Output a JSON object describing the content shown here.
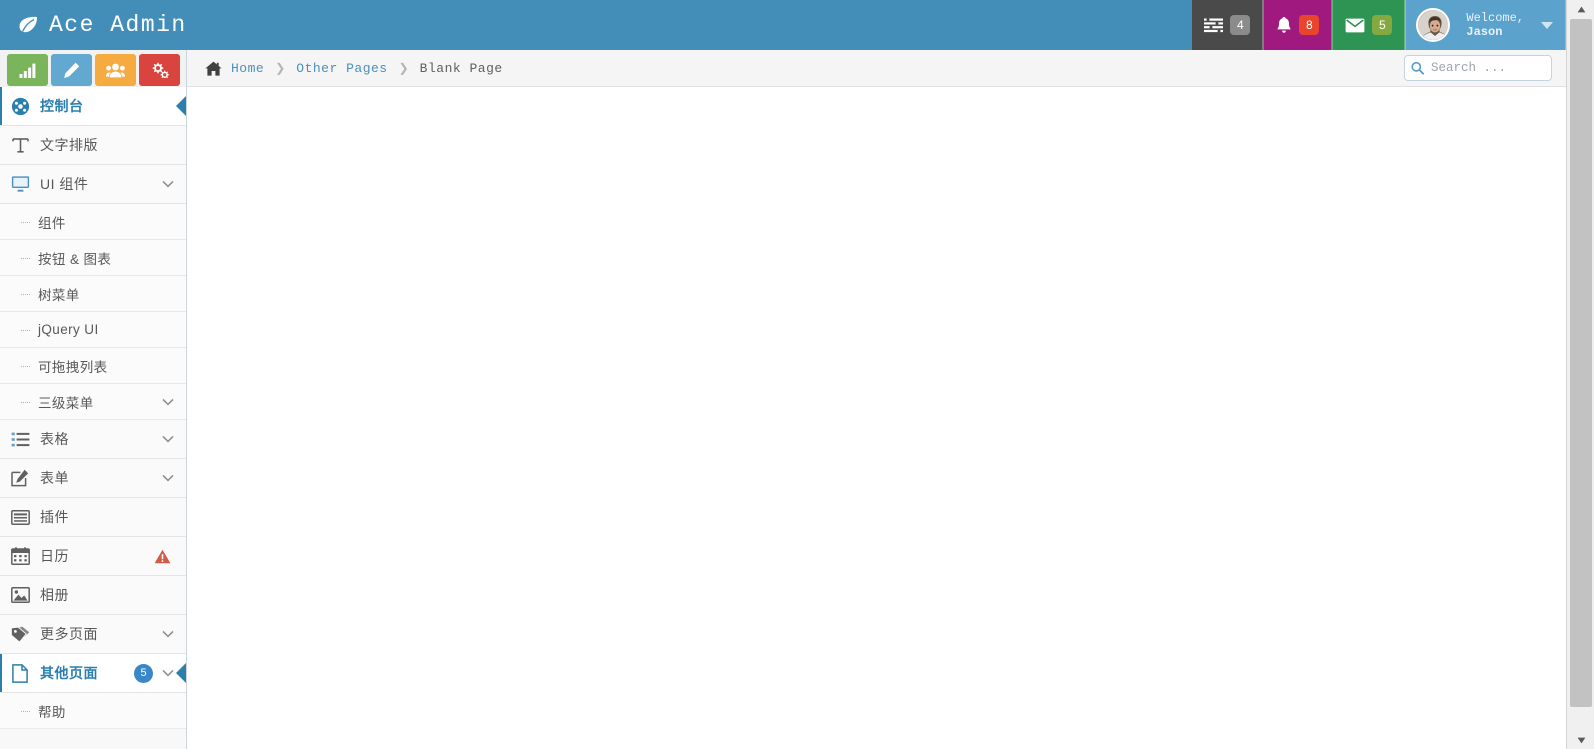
{
  "app": {
    "brand": "Ace Admin",
    "brand_icon": "leaf-icon",
    "header_color": "#438eb9"
  },
  "navbar": {
    "buttons": [
      {
        "name": "tasks",
        "icon": "tasks-icon",
        "badge": "4",
        "badge_color": "#8b8b8b",
        "bg": "#4a4a4a"
      },
      {
        "name": "notifications",
        "icon": "bell-icon",
        "badge": "8",
        "badge_color": "#e8452c",
        "bg": "#a0197f"
      },
      {
        "name": "messages",
        "icon": "envelope-icon",
        "badge": "5",
        "badge_color": "#85a941",
        "bg": "#2e9453"
      }
    ],
    "user": {
      "avatar_icon": "user-avatar",
      "greeting": "Welcome,",
      "username": "Jason",
      "caret_icon": "chevron-down-icon"
    }
  },
  "shortcuts": [
    {
      "name": "chart-shortcut",
      "icon": "signal-icon",
      "color": "#7ab55c"
    },
    {
      "name": "edit-shortcut",
      "icon": "pencil-icon",
      "color": "#62a8d1"
    },
    {
      "name": "users-shortcut",
      "icon": "group-icon",
      "color": "#f5ab3f"
    },
    {
      "name": "settings-shortcut",
      "icon": "cogs-icon",
      "color": "#d9443f"
    }
  ],
  "sidebar": {
    "items": [
      {
        "label": "控制台",
        "icon": "dashboard-icon",
        "active": true,
        "has_chevron": false
      },
      {
        "label": "文字排版",
        "icon": "typography-icon",
        "active": false,
        "has_chevron": false
      },
      {
        "label": "UI 组件",
        "icon": "monitor-icon",
        "active": false,
        "has_chevron": true
      },
      {
        "label": "表格",
        "icon": "list-icon",
        "active": false,
        "has_chevron": true
      },
      {
        "label": "表单",
        "icon": "edit-icon",
        "active": false,
        "has_chevron": true
      },
      {
        "label": "插件",
        "icon": "plugin-icon",
        "active": false,
        "has_chevron": false
      },
      {
        "label": "日历",
        "icon": "calendar-icon",
        "active": false,
        "has_chevron": false,
        "warning": "warning-icon"
      },
      {
        "label": "相册",
        "icon": "picture-icon",
        "active": false,
        "has_chevron": false
      },
      {
        "label": "更多页面",
        "icon": "tag-icon",
        "active": false,
        "has_chevron": true
      },
      {
        "label": "其他页面",
        "icon": "file-icon",
        "active": true,
        "has_chevron": true,
        "badge": "5",
        "badge_color": "#3a87c8"
      }
    ],
    "ui_submenu": [
      {
        "label": "组件",
        "has_chevron": false
      },
      {
        "label": "按钮 & 图表",
        "has_chevron": false
      },
      {
        "label": "树菜单",
        "has_chevron": false
      },
      {
        "label": "jQuery UI",
        "has_chevron": false
      },
      {
        "label": "可拖拽列表",
        "has_chevron": false
      },
      {
        "label": "三级菜单",
        "has_chevron": true
      }
    ],
    "other_submenu": [
      {
        "label": "帮助",
        "has_chevron": false
      }
    ]
  },
  "breadcrumb": {
    "home_icon": "home-icon",
    "items": [
      {
        "label": "Home",
        "current": false
      },
      {
        "label": "Other Pages",
        "current": false
      },
      {
        "label": "Blank Page",
        "current": true
      }
    ],
    "separator": "❯"
  },
  "search": {
    "placeholder": "Search ...",
    "value": "",
    "icon": "search-icon"
  },
  "main": {
    "content": ""
  }
}
